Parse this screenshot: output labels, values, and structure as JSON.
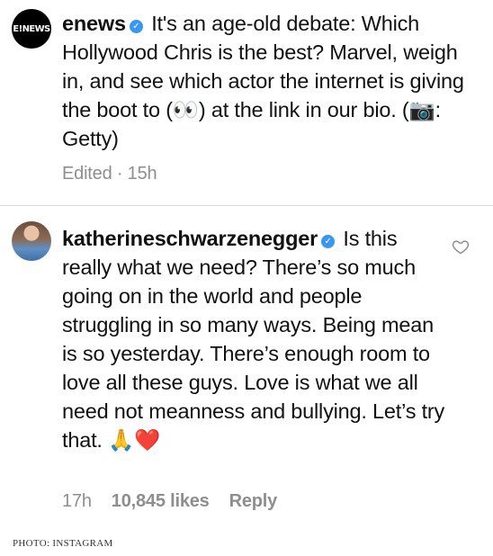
{
  "post": {
    "avatar_text": "E!NEWS",
    "username": "enews",
    "caption": "It's an age-old debate: Which Hollywood Chris is the best? Marvel, weigh in, and see which actor the internet is giving the boot to (👀) at the link in our bio. (📷: Getty)",
    "edited": "Edited · 15h"
  },
  "comment": {
    "username": "katherineschwarzenegger",
    "text": "Is this really what we need? There’s so much going on in the world and people struggling in so many ways. Being mean is so yesterday. There’s enough room to love all these guys. Love is what we all need not meanness and bullying. Let’s try that. 🙏❤️",
    "time": "17h",
    "likes": "10,845 likes",
    "reply_label": "Reply"
  },
  "icons": {
    "verified": "verified-badge-icon",
    "like": "heart-outline-icon"
  },
  "credit": "PHOTO: INSTAGRAM",
  "colors": {
    "verified": "#3897f0",
    "meta": "#8e8e8e",
    "divider": "#dbdbdb"
  }
}
